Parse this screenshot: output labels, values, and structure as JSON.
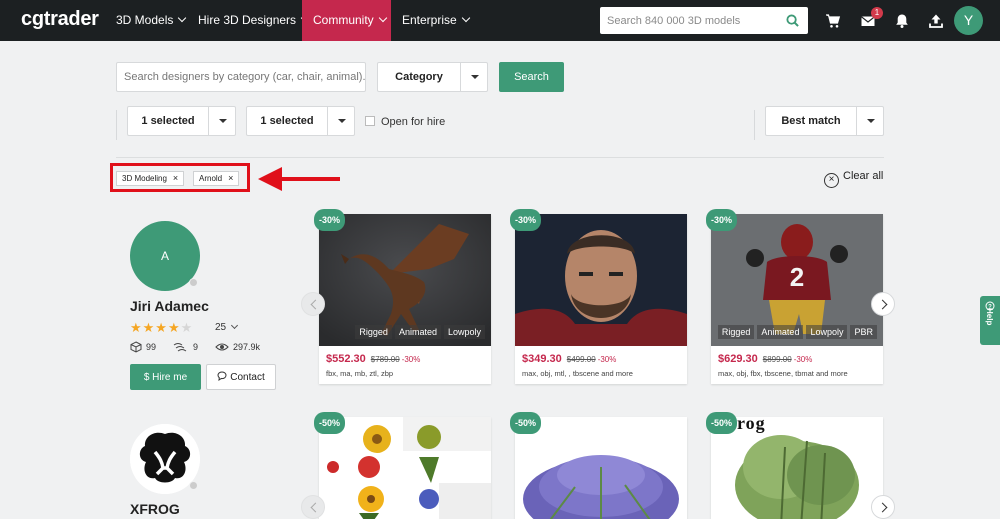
{
  "nav": {
    "logo": "cgtrader",
    "items": [
      {
        "label": "3D Models"
      },
      {
        "label": "Hire 3D Designers"
      },
      {
        "label": "Community"
      },
      {
        "label": "Enterprise"
      }
    ],
    "search_placeholder": "Search 840 000 3D models",
    "message_badge": "1",
    "avatar_initial": "Y"
  },
  "filters": {
    "designer_search_placeholder": "Search designers by category (car, chair, animal)...",
    "category_label": "Category",
    "search_button": "Search",
    "select1": "1 selected",
    "select2": "1 selected",
    "open_for_hire": "Open for hire",
    "sort": "Best match",
    "tags": [
      {
        "label": "3D Modeling"
      },
      {
        "label": "Arnold"
      }
    ],
    "clear_all": "Clear all"
  },
  "designers": [
    {
      "avatar_initial": "A",
      "name": "Jiri Adamec",
      "rating": 4.5,
      "reviews": "25",
      "models": "99",
      "followers": "9",
      "views": "297.9k",
      "hire_button": "$ Hire me",
      "contact_button": "Contact"
    },
    {
      "name": "XFROG"
    }
  ],
  "cards": [
    {
      "discount": "-30%",
      "tags": [
        "Rigged",
        "Animated",
        "Lowpoly"
      ],
      "price": "$552.30",
      "old_price": "$789.00",
      "off": "-30%",
      "formats": "fbx, ma, mb, ztl, zbp"
    },
    {
      "discount": "-30%",
      "tags": [],
      "price": "$349.30",
      "old_price": "$499.00",
      "off": "-30%",
      "formats": "max, obj, mtl, , tbscene and more"
    },
    {
      "discount": "-30%",
      "tags": [
        "Rigged",
        "Animated",
        "Lowpoly",
        "PBR"
      ],
      "price": "$629.30",
      "old_price": "$899.00",
      "off": "-30%",
      "formats": "max, obj, fbx, tbscene, tbmat and more"
    },
    {
      "discount": "-50%"
    },
    {
      "discount": "-50%"
    },
    {
      "discount": "-50%",
      "image_text": "rog"
    }
  ],
  "help": "Help",
  "colors": {
    "brand_green": "#3e9a77",
    "community_red": "#c5284d",
    "nav_bg": "#1c2022",
    "annotation_red": "#e0101a"
  }
}
